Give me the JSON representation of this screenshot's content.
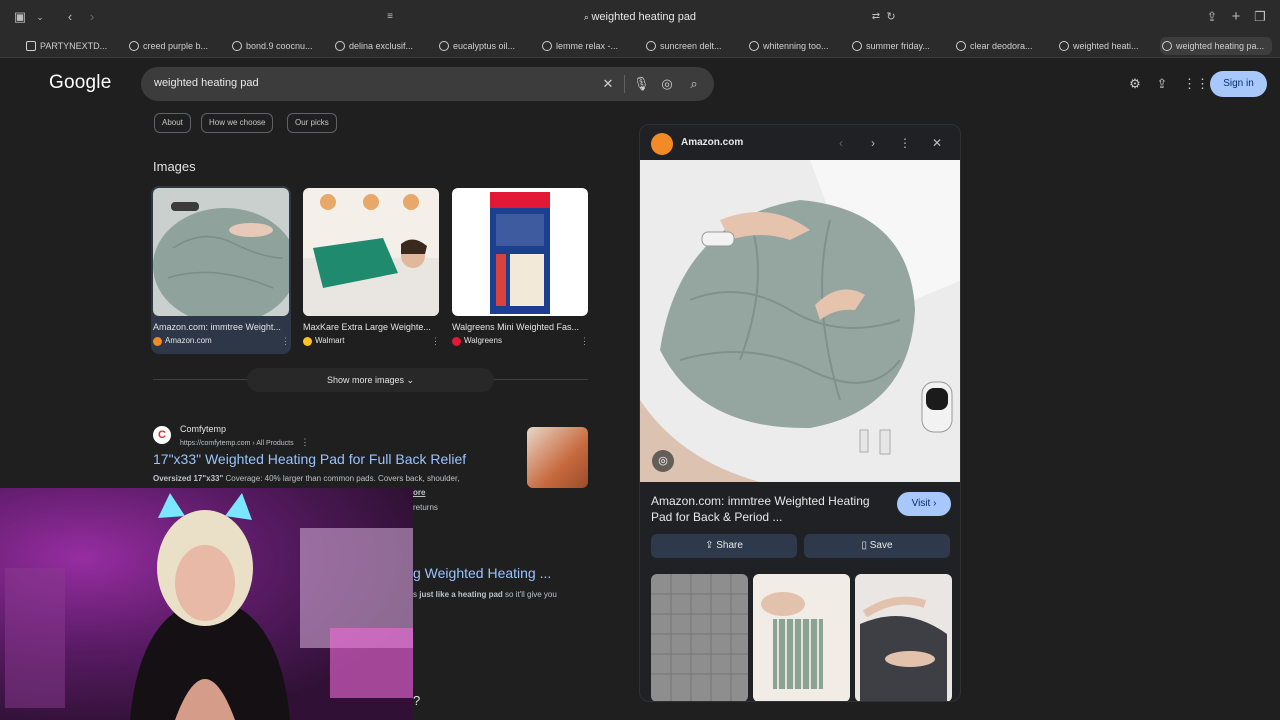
{
  "browser": {
    "address": "weighted heating pad",
    "tabs": [
      {
        "label": "PARTYNEXTD..."
      },
      {
        "label": "creed purple b..."
      },
      {
        "label": "bond.9 coocnu..."
      },
      {
        "label": "delina exclusif..."
      },
      {
        "label": "eucalyptus oil..."
      },
      {
        "label": "lemme relax -..."
      },
      {
        "label": "suncreen delt..."
      },
      {
        "label": "whitenning too..."
      },
      {
        "label": "summer friday..."
      },
      {
        "label": "clear deodora..."
      },
      {
        "label": "weighted heati..."
      },
      {
        "label": "weighted heating pa..."
      }
    ]
  },
  "header": {
    "logo": "Google",
    "query": "weighted heating pad",
    "signin": "Sign in"
  },
  "chips": [
    "About",
    "How we choose",
    "Our picks"
  ],
  "images": {
    "heading": "Images",
    "items": [
      {
        "caption": "Amazon.com: immtree Weight...",
        "source": "Amazon.com",
        "color": "#f28b26"
      },
      {
        "caption": "MaxKare Extra Large Weighte...",
        "source": "Walmart",
        "color": "#ffc220"
      },
      {
        "caption": "Walgreens Mini Weighted Fas...",
        "source": "Walgreens",
        "color": "#e31837"
      }
    ],
    "show_more": "Show more images"
  },
  "result": {
    "site": "Comfytemp",
    "url": "https://comfytemp.com › All Products",
    "title": "17\"x33\" Weighted Heating Pad for Full Back Relief",
    "snippet_bold": "Oversized 17\"x33\"",
    "snippet": " Coverage: 40% larger than common pads. Covers back, shoulder,",
    "more": "ore",
    "returns": "returns",
    "title2": "g Weighted Heating ...",
    "snippet2_pre": "s ",
    "snippet2_bold": "just like a heating pad",
    "snippet2_post": " so it'll give you",
    "qmark": "?"
  },
  "panel": {
    "source": "Amazon.com",
    "title": "Amazon.com: immtree Weighted Heating Pad for Back & Period ...",
    "visit": "Visit",
    "share": "Share",
    "save": "Save"
  },
  "colors": {
    "accent": "#a8c7fa",
    "link": "#99c3ff",
    "background": "#1f1f1f"
  }
}
